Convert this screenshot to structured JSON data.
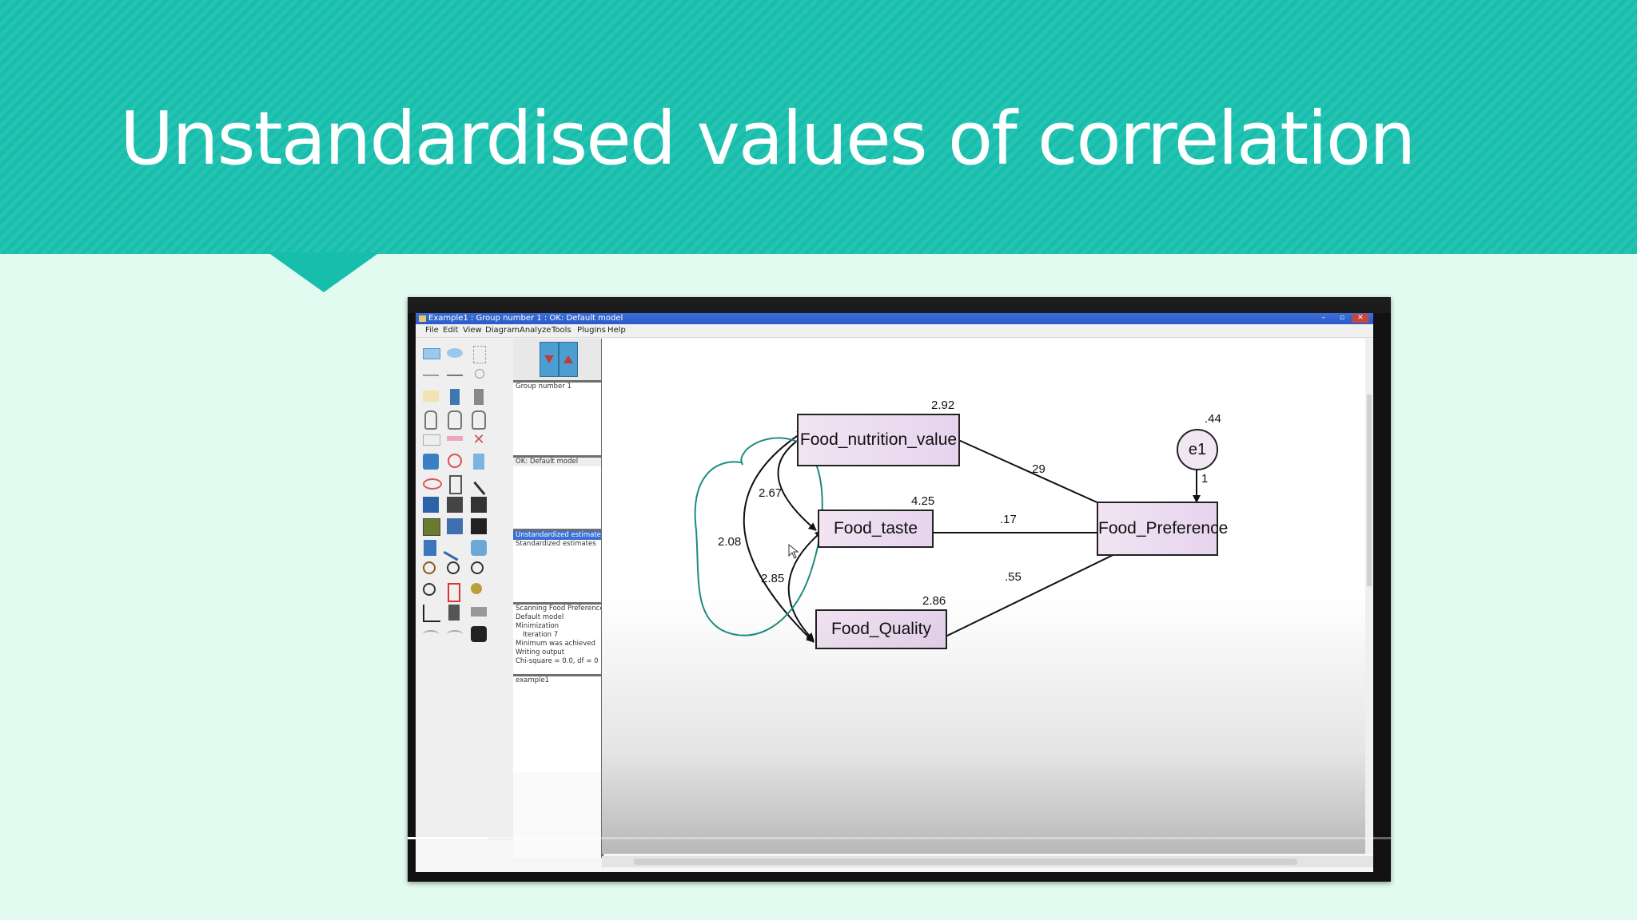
{
  "slide": {
    "title": "Unstandardised values of correlation"
  },
  "window": {
    "title": "Example1 : Group number 1 : OK: Default model",
    "controls": [
      "–",
      "▫",
      "✕"
    ]
  },
  "menu": [
    "File",
    "Edit",
    "View",
    "Diagram",
    "Analyze",
    "Tools",
    "Plugins",
    "Help"
  ],
  "panels": {
    "groups": [
      "Group number 1"
    ],
    "models": [
      "OK: Default model"
    ],
    "estimates": [
      "Unstandardized estimates",
      "Standardized estimates"
    ],
    "estimates_selected": "Unstandardized estimates",
    "log": [
      "Scanning Food Preference",
      "Default model",
      "Minimization",
      "  Iteration 7",
      "Minimum was achieved",
      "Writing output",
      "Chi-square = 0.0, df = 0"
    ],
    "files": [
      "example1"
    ]
  },
  "diagram": {
    "nodes": {
      "nutrition": "Food_nutrition_value",
      "taste": "Food_taste",
      "quality": "Food_Quality",
      "preference": "Food_Preference",
      "error": "e1"
    },
    "variances": {
      "nutrition": "2.92",
      "taste": "4.25",
      "quality": "2.86",
      "error": ".44"
    },
    "covariances": {
      "nutrition_taste": "2.67",
      "nutrition_quality": "2.08",
      "taste_quality": "2.85"
    },
    "paths": {
      "nutrition_to_preference": ".29",
      "taste_to_preference": ".17",
      "quality_to_preference": ".55",
      "error_to_preference": "1"
    }
  },
  "colors": {
    "banner": "#17beac",
    "background": "#e2fbf0",
    "annotation": "#1a8d7e",
    "node_fill": "#ead8f0"
  }
}
